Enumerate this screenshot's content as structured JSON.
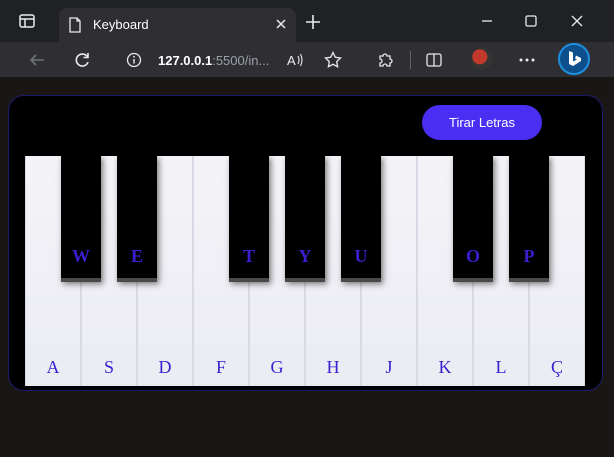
{
  "browser": {
    "tab_title": "Keyboard",
    "address_host": "127.0.0.1",
    "address_rest": ":5500/in..."
  },
  "page": {
    "toggle_button_label": "Tirar Letras",
    "white_keys": [
      "A",
      "S",
      "D",
      "F",
      "G",
      "H",
      "J",
      "K",
      "L",
      "Ç"
    ],
    "black_keys": [
      "W",
      "E",
      "T",
      "Y",
      "U",
      "O",
      "P"
    ],
    "accent_color": "#4a2ff2",
    "label_color": "#3a1fd1"
  }
}
